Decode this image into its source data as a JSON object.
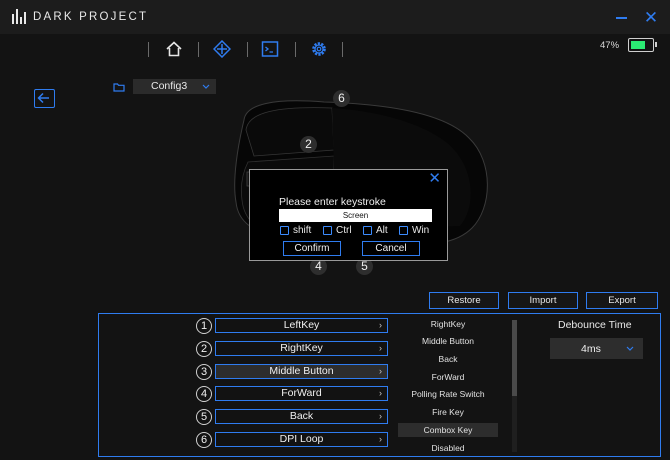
{
  "app": {
    "brand": "DARK PROJECT"
  },
  "nav": {
    "icons": [
      "home-icon",
      "crosshair-diamond-icon",
      "terminal-icon",
      "gear-icon"
    ]
  },
  "battery": {
    "percent_label": "47%",
    "level": 0.7,
    "color": "#2bea73"
  },
  "config": {
    "selected": "Config3"
  },
  "mouse_badges": [
    {
      "label": "6"
    },
    {
      "label": "2"
    },
    {
      "label": "4"
    },
    {
      "label": "5"
    }
  ],
  "dialog": {
    "title": "Please enter keystroke",
    "keystroke_value": "Screen",
    "modifiers": [
      "shift",
      "Ctrl",
      "Alt",
      "Win"
    ],
    "confirm_label": "Confirm",
    "cancel_label": "Cancel"
  },
  "actions": {
    "restore": "Restore",
    "import": "Import",
    "export": "Export"
  },
  "buttons": [
    {
      "num": "1",
      "label": "LeftKey"
    },
    {
      "num": "2",
      "label": "RightKey"
    },
    {
      "num": "3",
      "label": "Middle Button"
    },
    {
      "num": "4",
      "label": "ForWard"
    },
    {
      "num": "5",
      "label": "Back"
    },
    {
      "num": "6",
      "label": "DPI Loop"
    }
  ],
  "function_options": [
    "RightKey",
    "Middle Button",
    "Back",
    "ForWard",
    "Polling Rate Switch",
    "Fire Key",
    "Combox Key",
    "Disabled"
  ],
  "selected_option": "Combox Key",
  "debounce": {
    "title": "Debounce Time",
    "value": "4ms"
  },
  "colors": {
    "accent": "#2f7cf0",
    "battery": "#2bea73",
    "background": "#131313"
  }
}
